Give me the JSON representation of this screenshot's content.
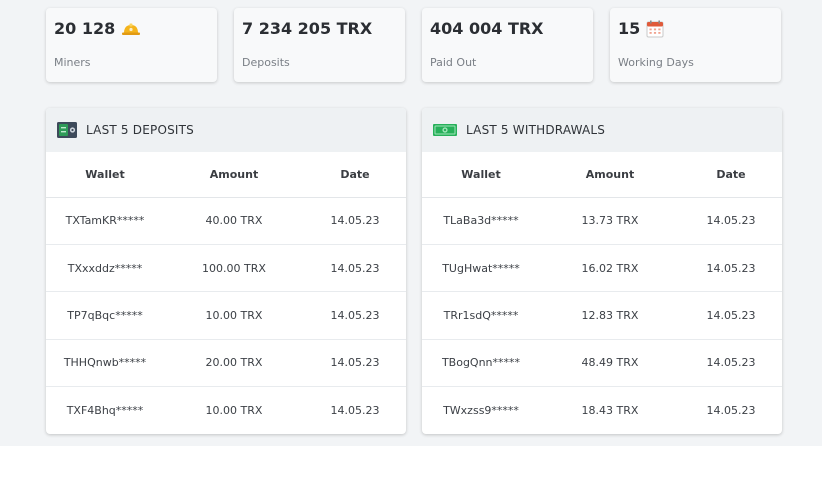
{
  "stats": [
    {
      "value": "20 128",
      "label": "Miners",
      "icon": "hardhat-icon"
    },
    {
      "value": "7 234 205 TRX",
      "label": "Deposits"
    },
    {
      "value": "404 004 TRX",
      "label": "Paid Out"
    },
    {
      "value": "15",
      "label": "Working Days",
      "icon": "calendar-icon"
    }
  ],
  "deposits": {
    "title": "LAST 5 DEPOSITS",
    "icon": "safe-icon",
    "columns": [
      "Wallet",
      "Amount",
      "Date"
    ],
    "rows": [
      {
        "wallet": "TXTamKR*****",
        "amount": "40.00 TRX",
        "date": "14.05.23"
      },
      {
        "wallet": "TXxxddz*****",
        "amount": "100.00 TRX",
        "date": "14.05.23"
      },
      {
        "wallet": "TP7qBqc*****",
        "amount": "10.00 TRX",
        "date": "14.05.23"
      },
      {
        "wallet": "THHQnwb*****",
        "amount": "20.00 TRX",
        "date": "14.05.23"
      },
      {
        "wallet": "TXF4Bhq*****",
        "amount": "10.00 TRX",
        "date": "14.05.23"
      }
    ]
  },
  "withdrawals": {
    "title": "LAST 5 WITHDRAWALS",
    "icon": "banknote-icon",
    "columns": [
      "Wallet",
      "Amount",
      "Date"
    ],
    "rows": [
      {
        "wallet": "TLaBa3d*****",
        "amount": "13.73 TRX",
        "date": "14.05.23"
      },
      {
        "wallet": "TUgHwat*****",
        "amount": "16.02 TRX",
        "date": "14.05.23"
      },
      {
        "wallet": "TRr1sdQ*****",
        "amount": "12.83 TRX",
        "date": "14.05.23"
      },
      {
        "wallet": "TBogQnn*****",
        "amount": "48.49 TRX",
        "date": "14.05.23"
      },
      {
        "wallet": "TWxzss9*****",
        "amount": "18.43 TRX",
        "date": "14.05.23"
      }
    ]
  },
  "colors": {
    "accent_orange": "#f2a81d",
    "safe_green": "#2e9a57",
    "banknote_green": "#27b05a"
  }
}
